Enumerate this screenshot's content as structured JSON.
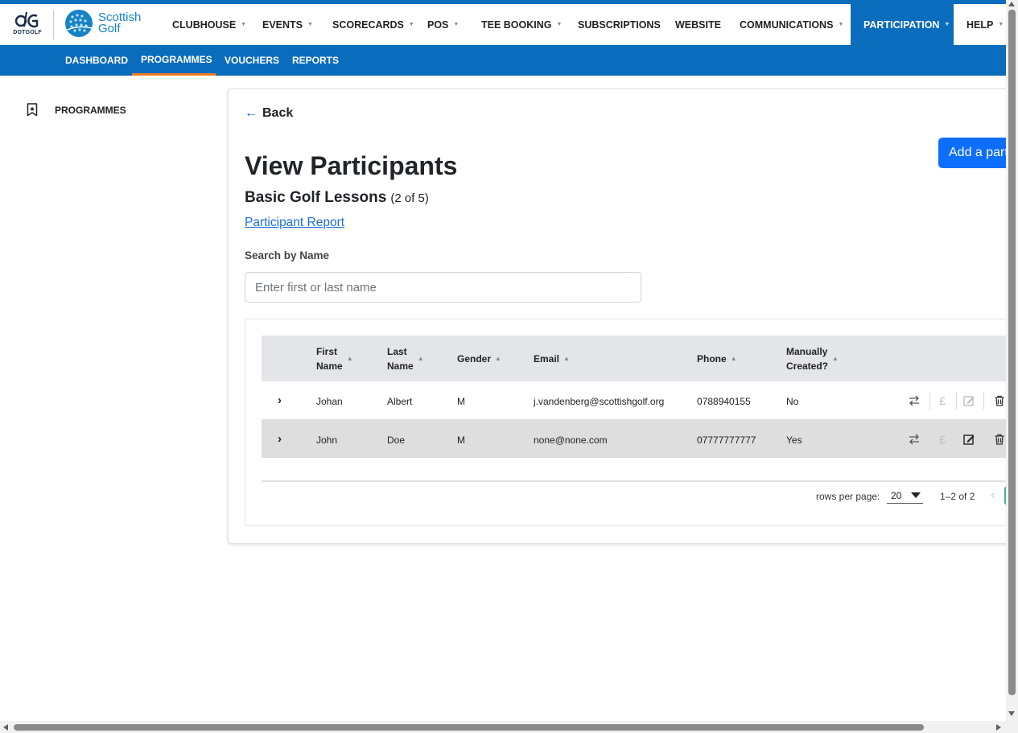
{
  "brand": {
    "dotgolf_label": "DOTGOLF",
    "scottish_golf_line1": "Scottish",
    "scottish_golf_line2": "Golf"
  },
  "topnav": {
    "items": [
      {
        "label": "CLUBHOUSE",
        "dropdown": true
      },
      {
        "label": "EVENTS",
        "dropdown": true
      },
      {
        "label": "SCORECARDS",
        "dropdown": true
      },
      {
        "label": "POS",
        "dropdown": true
      },
      {
        "label": "TEE BOOKING",
        "dropdown": true
      },
      {
        "label": "SUBSCRIPTIONS",
        "dropdown": false
      },
      {
        "label": "WEBSITE",
        "dropdown": false
      },
      {
        "label": "COMMUNICATIONS",
        "dropdown": true
      },
      {
        "label": "PARTICIPATION",
        "dropdown": true,
        "active": true
      },
      {
        "label": "HELP",
        "dropdown": true
      }
    ]
  },
  "subnav": {
    "items": [
      {
        "label": "DASHBOARD"
      },
      {
        "label": "PROGRAMMES",
        "active": true
      },
      {
        "label": "VOUCHERS"
      },
      {
        "label": "REPORTS"
      }
    ]
  },
  "sidebar": {
    "items": [
      {
        "label": "PROGRAMMES",
        "icon": "bookmark-icon"
      }
    ]
  },
  "main": {
    "back_label": "Back",
    "add_button_label": "Add a participant",
    "title": "View Participants",
    "programme_name": "Basic Golf Lessons",
    "programme_count": "(2 of 5)",
    "report_link": "Participant Report",
    "search_label": "Search by Name",
    "search_placeholder": "Enter first or last name",
    "search_value": ""
  },
  "table": {
    "columns": [
      {
        "line1": "First",
        "line2": "Name"
      },
      {
        "line1": "Last",
        "line2": "Name"
      },
      {
        "line1": "Gender",
        "line2": ""
      },
      {
        "line1": "Email",
        "line2": ""
      },
      {
        "line1": "Phone",
        "line2": ""
      },
      {
        "line1": "Manually",
        "line2": "Created?"
      }
    ],
    "rows": [
      {
        "first_name": "Johan",
        "last_name": "Albert",
        "gender": "M",
        "email": "j.vandenberg@scottishgolf.org",
        "phone": "0788940155",
        "manually_created": "No",
        "edit_enabled": false
      },
      {
        "first_name": "John",
        "last_name": "Doe",
        "gender": "M",
        "email": "none@none.com",
        "phone": "07777777777",
        "manually_created": "Yes",
        "edit_enabled": true
      }
    ]
  },
  "pagination": {
    "rows_per_page_label": "rows per page:",
    "rows_per_page_value": "20",
    "range_label": "1–2 of 2"
  },
  "colors": {
    "brand_blue": "#0a6cbd",
    "active_tab_underline": "#f07c1e",
    "primary_button": "#0d6efd",
    "link": "#1a6ed8"
  }
}
